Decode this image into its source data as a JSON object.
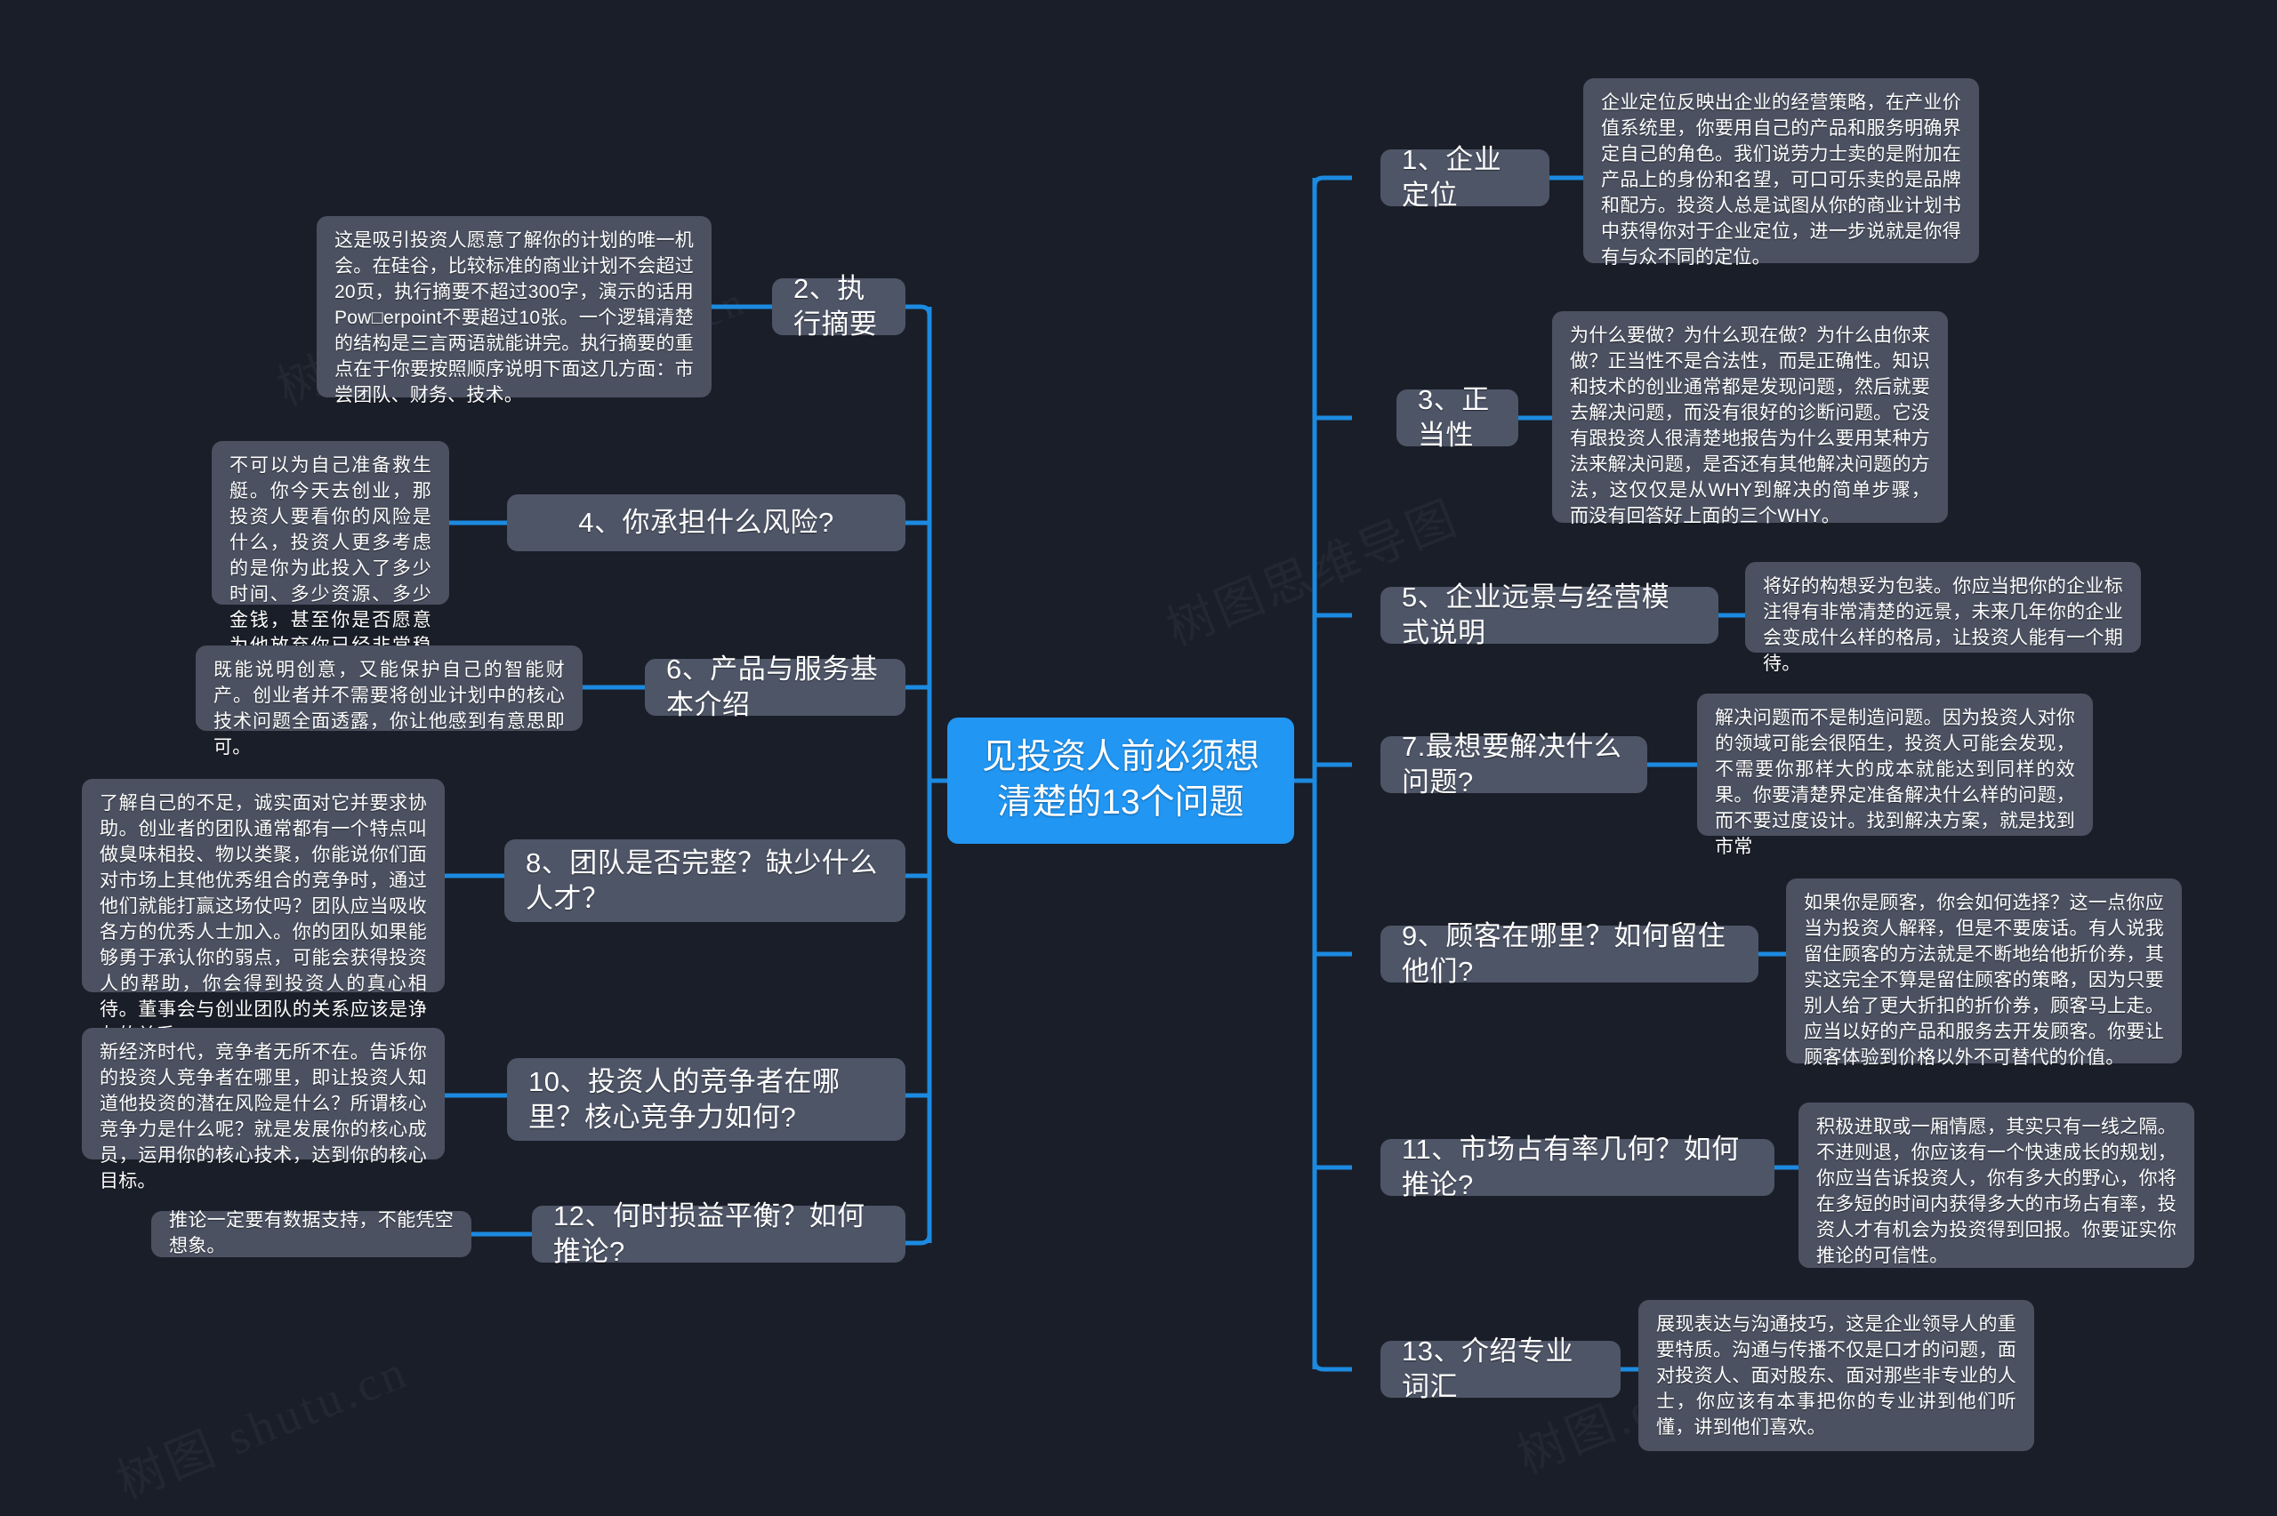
{
  "theme": {
    "background": "#1a1e28",
    "root_color": "#2196f3",
    "node_color": "#4e5567",
    "detail_color": "#4b5161",
    "link_color": "#1c8ae0",
    "text_color": "#ffffff"
  },
  "watermarks": [
    "树图 shutu.cn",
    "树图.cn",
    "树图思维导图",
    "树图 shutu.cn",
    "树图.cn"
  ],
  "root": {
    "label": "见投资人前必须想清楚的13个问题"
  },
  "branches": {
    "left": [
      {
        "id": "q2",
        "topic": "2、执行摘要",
        "detail": "这是吸引投资人愿意了解你的计划的唯一机会。在硅谷，比较标准的商业计划不会超过20页，执行摘要不超过300字，演示的话用Pow□erpoint不要超过10张。一个逻辑清楚的结构是三言两语就能讲完。执行摘要的重点在于你要按照顺序说明下面这几方面：市尝团队、财务、技术。"
      },
      {
        "id": "q4",
        "topic": "4、你承担什么风险?",
        "detail": "不可以为自己准备救生艇。你今天去创业，那投资人要看你的风险是什么，投资人更多考虑的是你为此投入了多少时间、多少资源、多少金钱，甚至你是否愿意为他放弃你已经非常稳定的工作和收入。投资人不会愿意承担比你更大的风险。"
      },
      {
        "id": "q6",
        "topic": "6、产品与服务基本介绍",
        "detail": "既能说明创意，又能保护自己的智能财产。创业者并不需要将创业计划中的核心技术问题全面透露，你让他感到有意思即可。"
      },
      {
        "id": "q8",
        "topic": "8、团队是否完整？缺少什么人才？",
        "detail": "了解自己的不足，诚实面对它并要求协助。创业者的团队通常都有一个特点叫做臭味相投、物以类聚，你能说你们面对市场上其他优秀组合的竞争时，通过他们就能打赢这场仗吗？团队应当吸收各方的优秀人士加入。你的团队如果能够勇于承认你的弱点，可能会获得投资人的帮助，你会得到投资人的真心相待。董事会与创业团队的关系应该是诤友的关系。"
      },
      {
        "id": "q10",
        "topic": "10、投资人的竞争者在哪里？核心竞争力如何?",
        "detail": "新经济时代，竞争者无所不在。告诉你的投资人竞争者在哪里，即让投资人知道他投资的潜在风险是什么？所谓核心竞争力是什么呢？就是发展你的核心成员，运用你的核心技术，达到你的核心目标。"
      },
      {
        "id": "q12",
        "topic": "12、何时损益平衡？如何推论?",
        "detail": "推论一定要有数据支持，不能凭空想象。"
      }
    ],
    "right": [
      {
        "id": "q1",
        "topic": "1、企业定位",
        "detail": "企业定位反映出企业的经营策略，在产业价值系统里，你要用自己的产品和服务明确界定自己的角色。我们说劳力士卖的是附加在产品上的身份和名望，可口可乐卖的是品牌和配方。投资人总是试图从你的商业计划书中获得你对于企业定位，进一步说就是你得有与众不同的定位。"
      },
      {
        "id": "q3",
        "topic": "3、正当性",
        "detail": "为什么要做？为什么现在做？为什么由你来做？正当性不是合法性，而是正确性。知识和技术的创业通常都是发现问题，然后就要去解决问题，而没有很好的诊断问题。它没有跟投资人很清楚地报告为什么要用某种方法来解决问题，是否还有其他解决问题的方法，这仅仅是从WHY到解决的简单步骤，而没有回答好上面的三个WHY。"
      },
      {
        "id": "q5",
        "topic": "5、企业远景与经营模式说明",
        "detail": "将好的构想妥为包装。你应当把你的企业标注得有非常清楚的远景，未来几年你的企业会变成什么样的格局，让投资人能有一个期待。"
      },
      {
        "id": "q7",
        "topic": "7.最想要解决什么问题?",
        "detail": "解决问题而不是制造问题。因为投资人对你的领域可能会很陌生，投资人可能会发现，不需要你那样大的成本就能达到同样的效果。你要清楚界定准备解决什么样的问题，而不要过度设计。找到解决方案，就是找到市常"
      },
      {
        "id": "q9",
        "topic": "9、顾客在哪里？如何留住他们?",
        "detail": "如果你是顾客，你会如何选择？这一点你应当为投资人解释，但是不要废话。有人说我留住顾客的方法就是不断地给他折价券，其实这完全不算是留住顾客的策略，因为只要别人给了更大折扣的折价券，顾客马上走。应当以好的产品和服务去开发顾客。你要让顾客体验到价格以外不可替代的价值。"
      },
      {
        "id": "q11",
        "topic": "11、市场占有率几何？如何推论?",
        "detail": "积极进取或一厢情愿，其实只有一线之隔。不进则退，你应该有一个快速成长的规划，你应当告诉投资人，你有多大的野心，你将在多短的时间内获得多大的市场占有率，投资人才有机会为投资得到回报。你要证实你推论的可信性。"
      },
      {
        "id": "q13",
        "topic": "13、介绍专业词汇",
        "detail": "展现表达与沟通技巧，这是企业领导人的重要特质。沟通与传播不仅是口才的问题，面对投资人、面对股东、面对那些非专业的人士，你应该有本事把你的专业讲到他们听懂，讲到他们喜欢。"
      }
    ]
  }
}
